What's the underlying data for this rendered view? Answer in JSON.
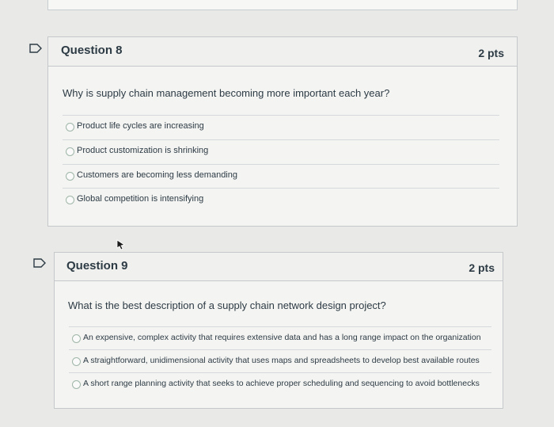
{
  "questions": [
    {
      "title": "Question 8",
      "points": "2 pts",
      "text": "Why is supply chain management becoming more important each year?",
      "answers": [
        "Product life cycles are increasing",
        "Product customization is shrinking",
        "Customers are becoming less demanding",
        "Global competition is intensifying"
      ]
    },
    {
      "title": "Question 9",
      "points": "2 pts",
      "text": "What is the best description of a supply chain network design project?",
      "answers": [
        "An expensive, complex activity that requires extensive data and has a long range impact on the organization",
        "A straightforward, unidimensional activity that uses maps and spreadsheets to develop best available routes",
        "A short range planning activity that seeks to achieve proper scheduling and sequencing to avoid bottlenecks"
      ]
    }
  ],
  "icons": {
    "flag": "flag-icon",
    "cursor": "mouse-cursor-icon"
  },
  "colors": {
    "background": "#e9e9e7",
    "card": "#f4f4f2",
    "border": "#c4c8cb",
    "text": "#2d3b45"
  }
}
